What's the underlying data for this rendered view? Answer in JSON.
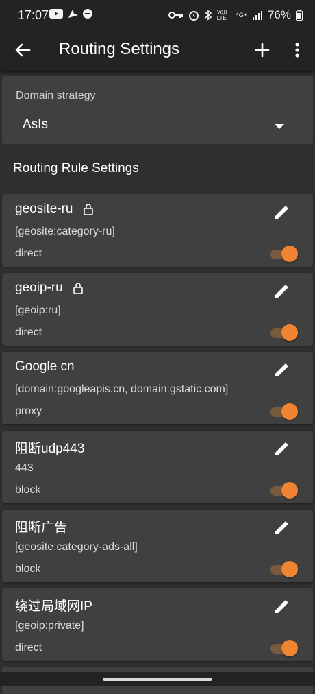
{
  "status_bar": {
    "time": "17:07",
    "battery": "76%",
    "icons_left": [
      "youtube-icon",
      "location-arrow-icon",
      "dnd-icon"
    ],
    "icons_right": [
      "vpn-key-icon",
      "alarm-icon",
      "bluetooth-icon",
      "volte-icon",
      "4g-icon",
      "signal-icon",
      "battery-icon"
    ],
    "volte_label": "Vo)) LTE",
    "network_label": "4G+"
  },
  "app_bar": {
    "title": "Routing Settings"
  },
  "domain_strategy": {
    "label": "Domain strategy",
    "value": "AsIs"
  },
  "section_title": "Routing Rule Settings",
  "rules": [
    {
      "name": "geosite-ru",
      "locked": true,
      "domain": "[geosite:category-ru]",
      "tag": "direct",
      "enabled": true
    },
    {
      "name": "geoip-ru",
      "locked": true,
      "domain": "[geoip:ru]",
      "tag": "direct",
      "enabled": true
    },
    {
      "name": "Google cn",
      "locked": false,
      "domain": "[domain:googleapis.cn, domain:gstatic.com]",
      "tag": "proxy",
      "enabled": true
    },
    {
      "name": "阻断udp443",
      "locked": false,
      "domain": "443",
      "tag": "block",
      "enabled": true
    },
    {
      "name": "阻断广告",
      "locked": false,
      "domain": "[geosite:category-ads-all]",
      "tag": "block",
      "enabled": true
    },
    {
      "name": "绕过局域网IP",
      "locked": false,
      "domain": "[geoip:private]",
      "tag": "direct",
      "enabled": true
    }
  ],
  "colors": {
    "accent": "#ef8433",
    "card": "#404040",
    "background": "#2f2f2f",
    "bar": "#232323"
  }
}
